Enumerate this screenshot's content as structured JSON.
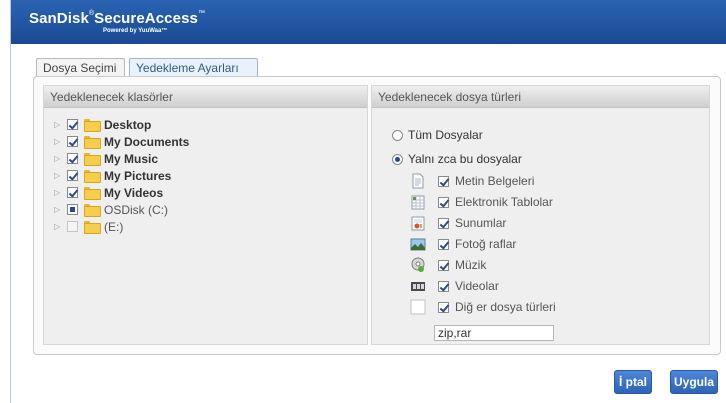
{
  "header": {
    "brand": "SanDisk",
    "brand_mark": "®",
    "brand_product": "SecureAccess",
    "brand_tm": "™",
    "powered_by": "Powered by YuuWaa™"
  },
  "tabs": [
    {
      "label": "Dosya Seçimi",
      "active": false
    },
    {
      "label": "Yedekleme Ayarları",
      "active": true
    }
  ],
  "left_panel": {
    "title": "Yedeklenecek klasörler",
    "folders": [
      {
        "label": "Desktop",
        "state": "checked",
        "bold": true
      },
      {
        "label": "My Documents",
        "state": "checked",
        "bold": true
      },
      {
        "label": "My Music",
        "state": "checked",
        "bold": true
      },
      {
        "label": "My Pictures",
        "state": "checked",
        "bold": true
      },
      {
        "label": "My Videos",
        "state": "checked",
        "bold": true
      },
      {
        "label": "OSDisk (C:)",
        "state": "partial",
        "bold": false
      },
      {
        "label": "(E:)",
        "state": "unchecked",
        "bold": false
      }
    ]
  },
  "right_panel": {
    "title": "Yedeklenecek dosya türleri",
    "radio_all": "Tüm Dosyalar",
    "radio_only": "Yalnı zca bu dosyalar",
    "selected_radio": "only",
    "types": [
      {
        "label": "Metin Belgeleri",
        "icon": "document-icon",
        "checked": true
      },
      {
        "label": "Elektronik Tablolar",
        "icon": "spreadsheet-icon",
        "checked": true
      },
      {
        "label": "Sunumlar",
        "icon": "presentation-icon",
        "checked": true
      },
      {
        "label": "Fotoğ raflar",
        "icon": "photo-icon",
        "checked": true
      },
      {
        "label": "Müzik",
        "icon": "music-icon",
        "checked": true
      },
      {
        "label": "Videolar",
        "icon": "video-icon",
        "checked": true
      },
      {
        "label": "Diğ er dosya türleri",
        "icon": "blank-file-icon",
        "checked": true
      }
    ],
    "extensions_value": "zip,rar"
  },
  "buttons": {
    "cancel": "İ ptal",
    "apply": "Uygula"
  },
  "colors": {
    "header_blue": "#2a63b3",
    "button_blue": "#2d63b8",
    "check_blue": "#2b4c88"
  }
}
